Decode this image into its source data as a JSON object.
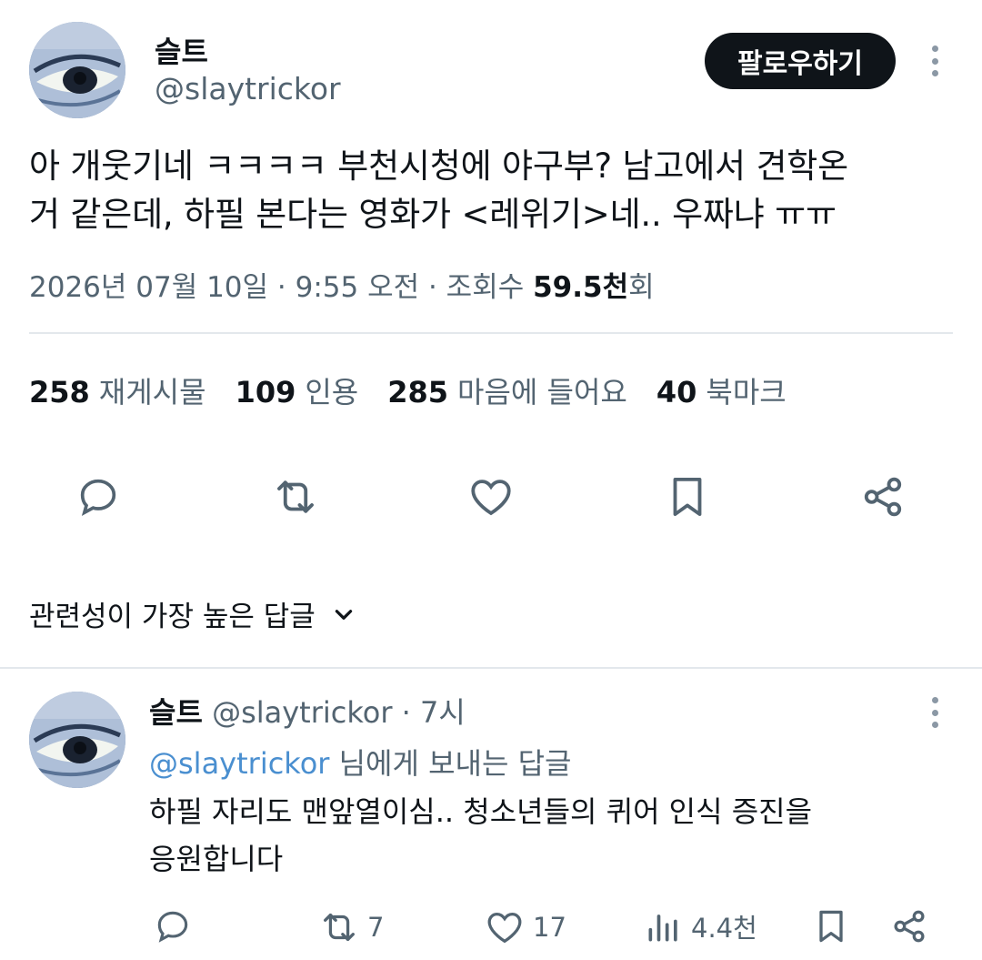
{
  "tweet": {
    "author_name": "슬트",
    "author_handle": "@slaytrickor",
    "follow_label": "팔로우하기",
    "text_line1": "아 개웃기네 ㅋㅋㅋㅋ 부천시청에 야구부? 남고에서 견학온",
    "text_line2": "거 같은데, 하필 본다는 영화가 <레위기>네.. 우짜냐 ㅠㅠ",
    "meta_prefix": "2026년 07월 10일 · 9:55 오전 · 조회수 ",
    "views_value": "59.5천",
    "views_suffix": "회"
  },
  "stats": {
    "reposts_count": "258",
    "reposts_label": "재게시물",
    "quotes_count": "109",
    "quotes_label": "인용",
    "likes_count": "285",
    "likes_label": "마음에 들어요",
    "bookmarks_count": "40",
    "bookmarks_label": "북마크"
  },
  "actions": [
    "reply-icon",
    "repost-icon",
    "heart-icon",
    "bookmark-icon",
    "share-icon"
  ],
  "sort": {
    "label": "관련성이 가장 높은 답글"
  },
  "reply": {
    "author_name": "슬트",
    "author_handle": "@slaytrickor",
    "time": "· 7시",
    "replying_to_handle": "@slaytrickor",
    "replying_to_suffix": " 님에게 보내는 답글",
    "text_line1": "하필 자리도 맨앞열이심.. 청소년들의 퀴어 인식 증진을",
    "text_line2": "응원합니다",
    "repost_count": "7",
    "like_count": "17",
    "views_count": "4.4천"
  },
  "colors": {
    "text": "#0f1419",
    "muted": "#536471",
    "icon": "#536471",
    "mention": "#4a8fd0",
    "divider": "#e3e8ec"
  }
}
